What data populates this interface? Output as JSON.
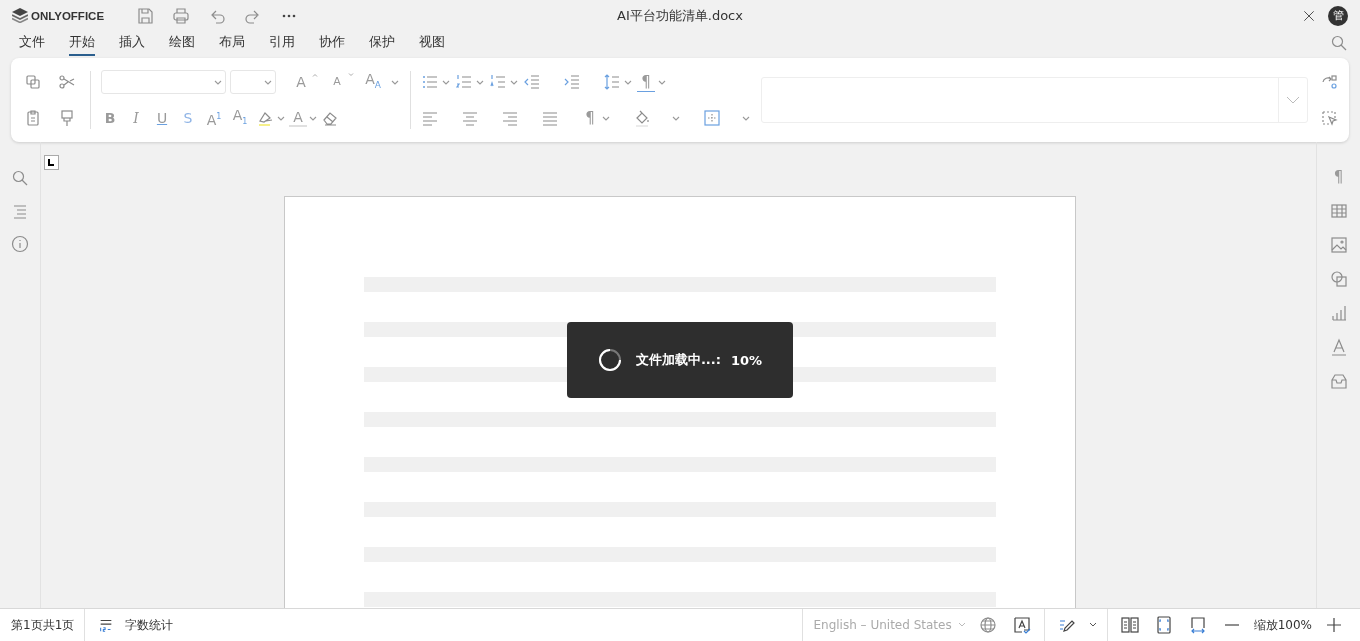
{
  "app": {
    "logo": "ONLYOFFICE",
    "title": "AI平台功能清单.docx",
    "avatar": "管"
  },
  "menu_tabs": [
    {
      "label": "文件",
      "selected": false
    },
    {
      "label": "开始",
      "selected": true
    },
    {
      "label": "插入",
      "selected": false
    },
    {
      "label": "绘图",
      "selected": false
    },
    {
      "label": "布局",
      "selected": false
    },
    {
      "label": "引用",
      "selected": false
    },
    {
      "label": "协作",
      "selected": false
    },
    {
      "label": "保护",
      "selected": false
    },
    {
      "label": "视图",
      "selected": false
    }
  ],
  "ribbon": {
    "font_size_glyphs": [
      "A",
      "A",
      "A$_{A}$"
    ],
    "format_glyphs": [
      "B",
      "I",
      "U",
      "S",
      "A$^{1}$",
      "A$_{1}$"
    ],
    "font_color_glyph": "A",
    "pilcrow_glyphs": [
      "¶",
      "¶"
    ]
  },
  "right_rail": {
    "pilcrow_glyph": "¶"
  },
  "loading": {
    "message": "文件加载中...:",
    "percent": "10%"
  },
  "status_bar": {
    "page": "第1页共1页",
    "word_count": "字数统计",
    "language": "English – United States",
    "zoom": "缩放100%"
  }
}
